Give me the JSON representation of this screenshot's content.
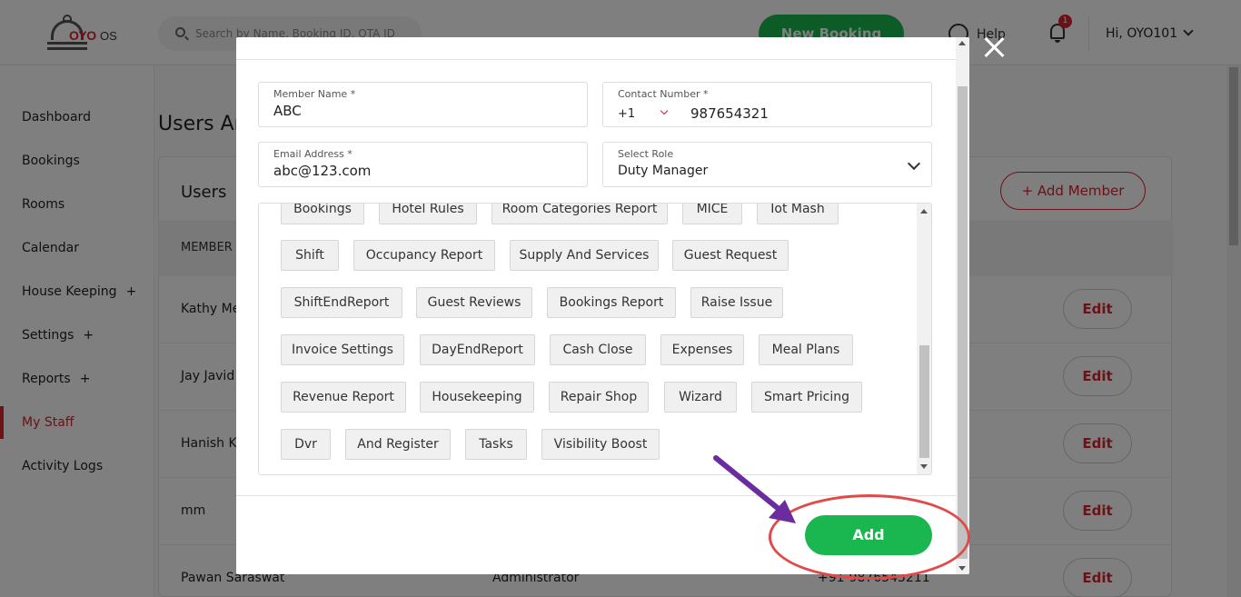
{
  "app": {
    "logo_text": "OYO",
    "logo_suffix": "OS",
    "search_placeholder": "Search by Name, Booking ID, OTA ID",
    "new_booking": "New Booking",
    "help": "Help",
    "notification_count": "1",
    "user_greeting": "Hi, OYO101",
    "brand_color": "#d9232d",
    "accent_green": "#1ab64f"
  },
  "sidebar": {
    "items": [
      {
        "label": "Dashboard",
        "plus": ""
      },
      {
        "label": "Bookings",
        "plus": ""
      },
      {
        "label": "Rooms",
        "plus": ""
      },
      {
        "label": "Calendar",
        "plus": ""
      },
      {
        "label": "House Keeping",
        "plus": "+"
      },
      {
        "label": "Settings",
        "plus": "+"
      },
      {
        "label": "Reports",
        "plus": "+"
      },
      {
        "label": "My Staff",
        "plus": ""
      },
      {
        "label": "Activity Logs",
        "plus": ""
      }
    ],
    "active": "My Staff"
  },
  "page": {
    "title": "Users An",
    "card_title": "Users",
    "add_member": "+  Add Member",
    "column_header": "MEMBER",
    "rows": [
      {
        "name": "Kathy Me",
        "role": "",
        "phone": "",
        "edit": "Edit"
      },
      {
        "name": "Jay Javid",
        "role": "",
        "phone": "",
        "edit": "Edit"
      },
      {
        "name": "Hanish K",
        "role": "",
        "phone": "",
        "edit": "Edit"
      },
      {
        "name": "mm",
        "role": "",
        "phone": "",
        "edit": "Edit"
      },
      {
        "name": "Pawan Saraswat",
        "role": "Administrator",
        "phone": "+91-9876543211",
        "edit": "Edit"
      }
    ]
  },
  "modal": {
    "member_name": {
      "label": "Member Name *",
      "value": "ABC"
    },
    "contact_number": {
      "label": "Contact Number *",
      "code": "+1",
      "value": "987654321"
    },
    "email": {
      "label": "Email Address *",
      "value": "abc@123.com"
    },
    "role": {
      "label": "Select Role",
      "value": "Duty Manager"
    },
    "permissions": [
      "Bookings",
      "Hotel Rules",
      "Room Categories Report",
      "MICE",
      "Iot Mash",
      "Shift",
      "Occupancy Report",
      "Supply And Services",
      "Guest Request",
      "ShiftEndReport",
      "Guest Reviews",
      "Bookings Report",
      "Raise Issue",
      "Invoice Settings",
      "DayEndReport",
      "Cash Close",
      "Expenses",
      "Meal Plans",
      "Revenue Report",
      "Housekeeping",
      "Repair Shop",
      "Wizard",
      "Smart Pricing",
      "Dvr",
      "And Register",
      "Tasks",
      "Visibility Boost"
    ],
    "add_button": "Add"
  }
}
